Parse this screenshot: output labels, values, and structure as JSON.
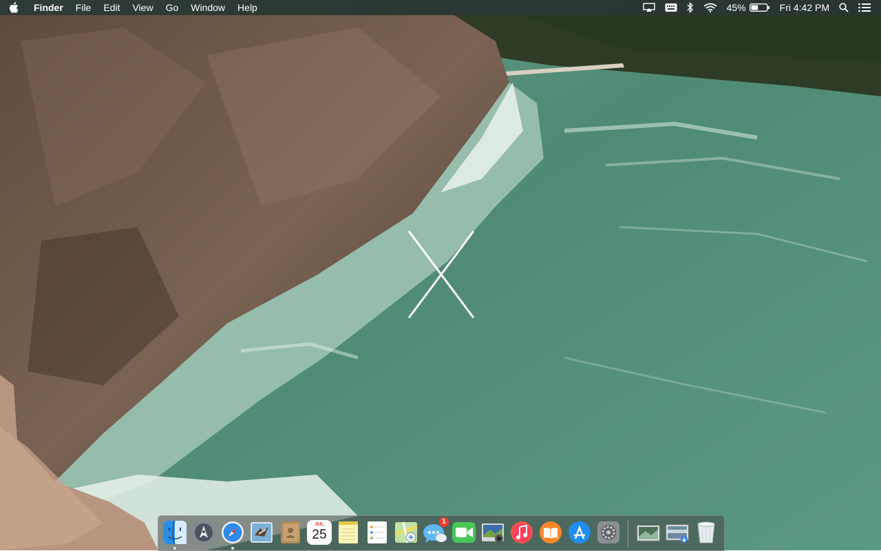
{
  "menubar": {
    "apple_icon": "apple-icon",
    "app_name": "Finder",
    "menus": [
      "File",
      "Edit",
      "View",
      "Go",
      "Window",
      "Help"
    ],
    "battery_percent": "45%",
    "clock": "Fri 4:42 PM",
    "status_icons": [
      "airplay-icon",
      "keyboard-input-icon",
      "bluetooth-icon",
      "wifi-icon",
      "battery-icon",
      "spotlight-search-icon",
      "notification-center-icon"
    ]
  },
  "desktop": {
    "wallpaper": "Yosemite waterfall wallpaper",
    "logo": "OS X"
  },
  "dock": {
    "apps": [
      {
        "name": "Finder",
        "icon": "finder-icon",
        "running": true
      },
      {
        "name": "Launchpad",
        "icon": "launchpad-icon",
        "running": false
      },
      {
        "name": "Safari",
        "icon": "safari-icon",
        "running": true
      },
      {
        "name": "Mail",
        "icon": "mail-icon",
        "running": false
      },
      {
        "name": "Contacts",
        "icon": "contacts-icon",
        "running": false
      },
      {
        "name": "Calendar",
        "icon": "calendar-icon",
        "running": false,
        "month": "JUL",
        "day": "25"
      },
      {
        "name": "Notes",
        "icon": "notes-icon",
        "running": false
      },
      {
        "name": "Reminders",
        "icon": "reminders-icon",
        "running": false
      },
      {
        "name": "Maps",
        "icon": "maps-icon",
        "running": false
      },
      {
        "name": "Messages",
        "icon": "messages-icon",
        "running": false,
        "badge": "1"
      },
      {
        "name": "FaceTime",
        "icon": "facetime-icon",
        "running": false
      },
      {
        "name": "Photo Booth",
        "icon": "photo-booth-icon",
        "running": false
      },
      {
        "name": "iTunes",
        "icon": "itunes-icon",
        "running": false
      },
      {
        "name": "iBooks",
        "icon": "ibooks-icon",
        "running": false
      },
      {
        "name": "App Store",
        "icon": "app-store-icon",
        "running": false
      },
      {
        "name": "System Preferences",
        "icon": "system-preferences-icon",
        "running": false
      }
    ],
    "stacks": [
      {
        "name": "Documents",
        "icon": "documents-stack-icon"
      },
      {
        "name": "Downloads",
        "icon": "downloads-stack-icon"
      },
      {
        "name": "Trash",
        "icon": "trash-icon"
      }
    ]
  },
  "colors": {
    "menubar": "#1e1e1e",
    "badge": "#f23b30",
    "water": "#4f8f79",
    "rock": "#6b5547"
  }
}
